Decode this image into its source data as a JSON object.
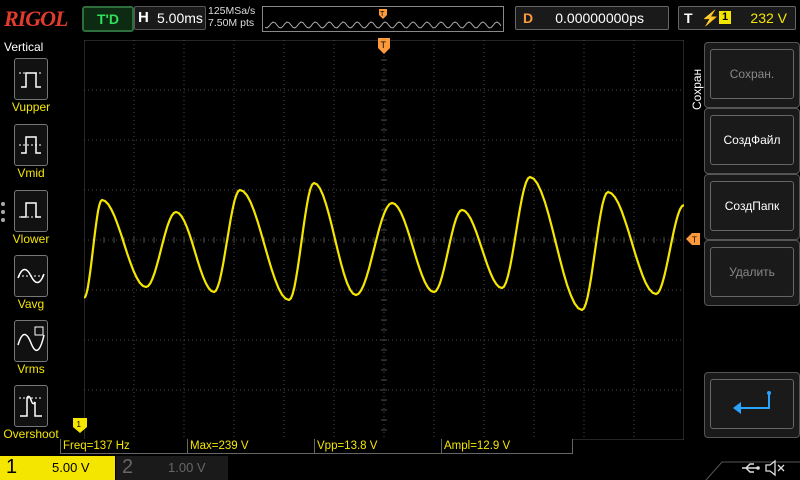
{
  "top": {
    "logo": "RIGOL",
    "run_status": "T'D",
    "horizontal_key": "H",
    "timebase": "5.00ms",
    "sample_rate": "125MSa/s",
    "memory_depth": "7.50M pts",
    "delay_key": "D",
    "delay_value": "0.00000000ps",
    "trigger_key": "T",
    "trigger_edge": "⚡",
    "trigger_source": "1",
    "trigger_level": "232 V"
  },
  "left_menu": {
    "title": "Vertical",
    "items": [
      {
        "label": "Vupper"
      },
      {
        "label": "Vmid"
      },
      {
        "label": "Vlower"
      },
      {
        "label": "Vavg"
      },
      {
        "label": "Vrms"
      },
      {
        "label": "Overshoot"
      }
    ]
  },
  "right_menu": {
    "title": "Сохран",
    "buttons": [
      {
        "label": "Сохран.",
        "enabled": false
      },
      {
        "label": "СоздФайл",
        "enabled": true
      },
      {
        "label": "СоздПапк",
        "enabled": true
      },
      {
        "label": "Удалить",
        "enabled": false
      },
      {
        "label": "↵",
        "enabled": true
      }
    ]
  },
  "measurements": [
    {
      "text": "Freq=137 Hz"
    },
    {
      "text": "Max=239 V"
    },
    {
      "text": "Vpp=13.8 V"
    },
    {
      "text": "Ampl=12.9 V"
    }
  ],
  "channels": {
    "ch1": {
      "number": "1",
      "scale": "5.00 V",
      "color": "#f5e600"
    },
    "ch2": {
      "number": "2",
      "scale": "1.00 V",
      "color": "#00a5e0"
    }
  },
  "icons": {
    "usb": "usb-icon",
    "speaker": "speaker-muted-icon"
  },
  "colors": {
    "trace": "#f5e600",
    "trigger_marker": "#ff9a3c",
    "grid": "#4a4a4a",
    "status_green": "#2ee05a"
  }
}
